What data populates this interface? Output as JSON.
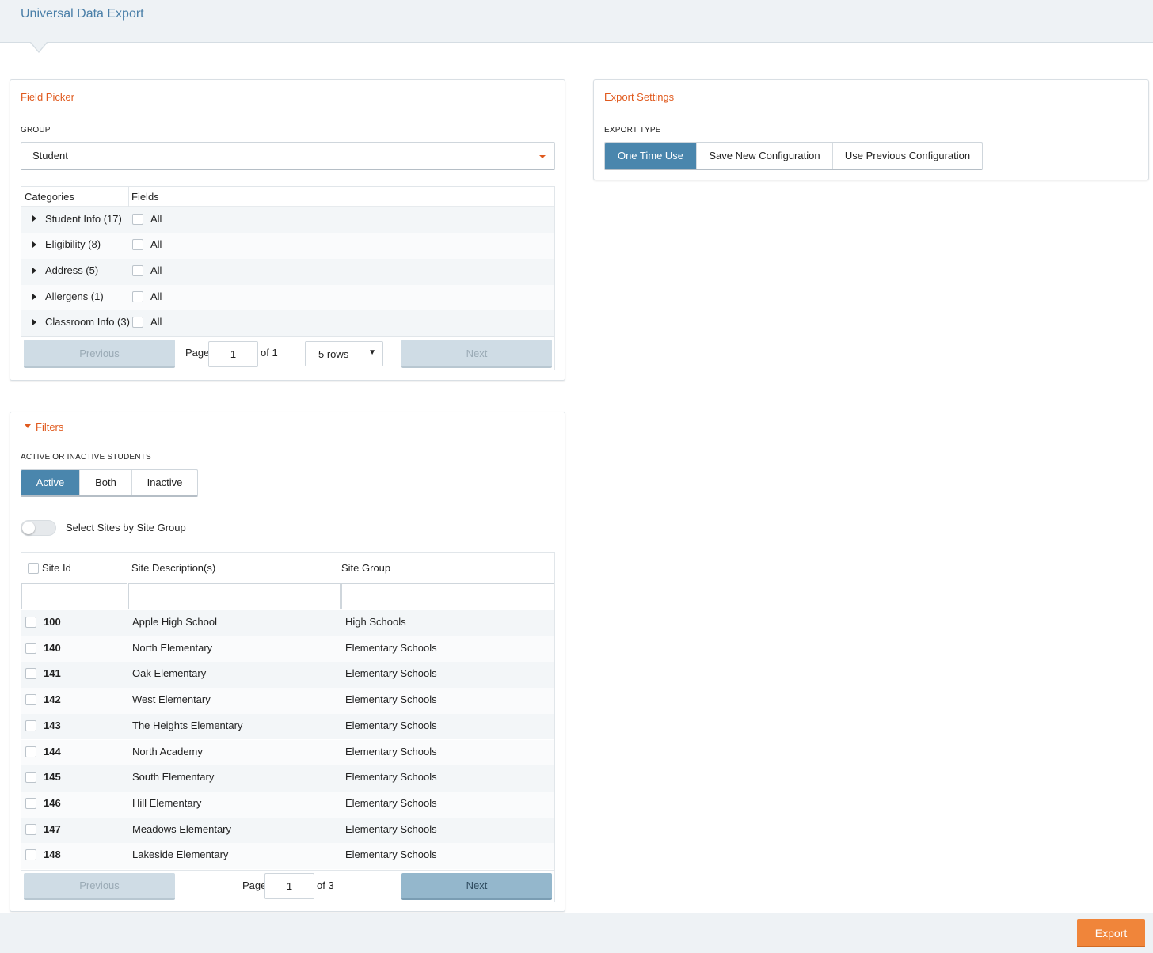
{
  "header": {
    "title": "Universal Data Export"
  },
  "field_picker": {
    "title": "Field Picker",
    "group_label": "GROUP",
    "group_value": "Student",
    "columns": [
      "Categories",
      "Fields"
    ],
    "rows": [
      {
        "category": "Student Info (17)",
        "field": "All"
      },
      {
        "category": "Eligibility (8)",
        "field": "All"
      },
      {
        "category": "Address (5)",
        "field": "All"
      },
      {
        "category": "Allergens (1)",
        "field": "All"
      },
      {
        "category": "Classroom Info (3)",
        "field": "All"
      }
    ],
    "pager": {
      "previous": "Previous",
      "page_label": "Page",
      "page": "1",
      "of": "of 1",
      "rows_select": "5 rows",
      "next": "Next"
    }
  },
  "export_settings": {
    "title": "Export Settings",
    "type_label": "EXPORT TYPE",
    "options": [
      "One Time Use",
      "Save New Configuration",
      "Use Previous Configuration"
    ],
    "selected": "One Time Use"
  },
  "filters": {
    "title": "Filters",
    "status_label": "ACTIVE OR INACTIVE STUDENTS",
    "status_options": [
      "Active",
      "Both",
      "Inactive"
    ],
    "status_selected": "Active",
    "toggle_label": "Select Sites by Site Group",
    "toggle_on": false,
    "columns": [
      "Site Id",
      "Site Description(s)",
      "Site Group"
    ],
    "rows": [
      {
        "id": "100",
        "desc": "Apple High School",
        "group": "High Schools"
      },
      {
        "id": "140",
        "desc": "North Elementary",
        "group": "Elementary Schools"
      },
      {
        "id": "141",
        "desc": "Oak Elementary",
        "group": "Elementary Schools"
      },
      {
        "id": "142",
        "desc": "West Elementary",
        "group": "Elementary Schools"
      },
      {
        "id": "143",
        "desc": "The Heights Elementary",
        "group": "Elementary Schools"
      },
      {
        "id": "144",
        "desc": "North Academy",
        "group": "Elementary Schools"
      },
      {
        "id": "145",
        "desc": "South Elementary",
        "group": "Elementary Schools"
      },
      {
        "id": "146",
        "desc": "Hill Elementary",
        "group": "Elementary Schools"
      },
      {
        "id": "147",
        "desc": "Meadows Elementary",
        "group": "Elementary Schools"
      },
      {
        "id": "148",
        "desc": "Lakeside Elementary",
        "group": "Elementary Schools"
      }
    ],
    "pager": {
      "previous": "Previous",
      "page_label": "Page",
      "page": "1",
      "of": "of 3",
      "next": "Next"
    }
  },
  "footer": {
    "export": "Export"
  },
  "colors": {
    "accent_orange": "#e05a1e",
    "primary_blue": "#4a86ad",
    "export_orange": "#f0853a"
  }
}
